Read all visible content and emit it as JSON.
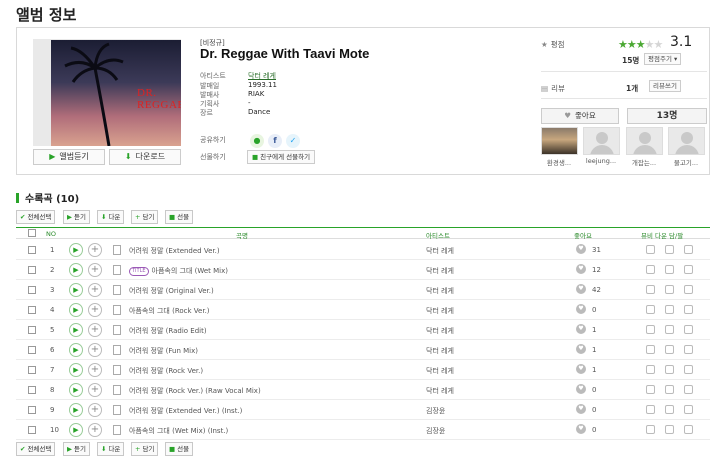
{
  "page_title": "앨범 정보",
  "album": {
    "badge": "[비정규]",
    "title": "Dr. Reggae With Taavi Mote",
    "cover_text": "DR. REGGAE",
    "meta": [
      {
        "label": "아티스트",
        "value": "닥터 레게"
      },
      {
        "label": "발매일",
        "value": "1993.11"
      },
      {
        "label": "발매사",
        "value": "RIAK"
      },
      {
        "label": "기획사",
        "value": "-"
      },
      {
        "label": "장르",
        "value": "Dance"
      }
    ],
    "share_label": "공유하기",
    "gift_label": "선물하기",
    "gift_button": "친구에게 선물하기",
    "listen_button": "앨범듣기",
    "download_button": "다운로드"
  },
  "rating": {
    "label": "평점",
    "value": 3.1,
    "display": "3.1",
    "stars": [
      "on",
      "on",
      "on",
      "off",
      "off"
    ],
    "count": "15명",
    "rate_button": "평점주기 ▾"
  },
  "review": {
    "label": "리뷰",
    "count": "1개",
    "write_button": "리뷰쓰기"
  },
  "like": {
    "button": "좋아요",
    "count": "13명",
    "users": [
      "환경생...",
      "leejung...",
      "개잡는...",
      "물고기..."
    ]
  },
  "tracklist": {
    "title": "수록곡",
    "count": "(10)",
    "toolbar": {
      "select_all": "전체선택",
      "listen": "듣기",
      "download": "다운",
      "add": "담기",
      "gift": "선물"
    },
    "headers": {
      "no": "NO",
      "song": "곡명",
      "artist": "아티스트",
      "like": "좋아요",
      "actions": "뮤비 다운 담/팔"
    },
    "tracks": [
      {
        "no": "1",
        "title": "어려워 정말 (Extended Ver.)",
        "title_badge": "",
        "artist": "닥터 레게",
        "likes": "31"
      },
      {
        "no": "2",
        "title": "아픔속의 그대 (Wet Mix)",
        "title_badge": "TITLE",
        "artist": "닥터 레게",
        "likes": "12"
      },
      {
        "no": "3",
        "title": "어려워 정말 (Original Ver.)",
        "title_badge": "",
        "artist": "닥터 레게",
        "likes": "42"
      },
      {
        "no": "4",
        "title": "아픔속의 그대 (Rock Ver.)",
        "title_badge": "",
        "artist": "닥터 레게",
        "likes": "0"
      },
      {
        "no": "5",
        "title": "어려워 정말 (Radio Edit)",
        "title_badge": "",
        "artist": "닥터 레게",
        "likes": "1"
      },
      {
        "no": "6",
        "title": "어려워 정말 (Fun Mix)",
        "title_badge": "",
        "artist": "닥터 레게",
        "likes": "1"
      },
      {
        "no": "7",
        "title": "어려워 정말 (Rock Ver.)",
        "title_badge": "",
        "artist": "닥터 레게",
        "likes": "1"
      },
      {
        "no": "8",
        "title": "어려워 정말 (Rock Ver.) (Raw Vocal Mix)",
        "title_badge": "",
        "artist": "닥터 레게",
        "likes": "0"
      },
      {
        "no": "9",
        "title": "어려워 정말 (Extended Ver.) (Inst.)",
        "title_badge": "",
        "artist": "김장윤",
        "likes": "0"
      },
      {
        "no": "10",
        "title": "아픔속의 그대 (Wet Mix) (Inst.)",
        "title_badge": "",
        "artist": "김장윤",
        "likes": "0"
      }
    ]
  },
  "colors": {
    "accent": "#29a329",
    "title_badge": "#9b59b6"
  }
}
